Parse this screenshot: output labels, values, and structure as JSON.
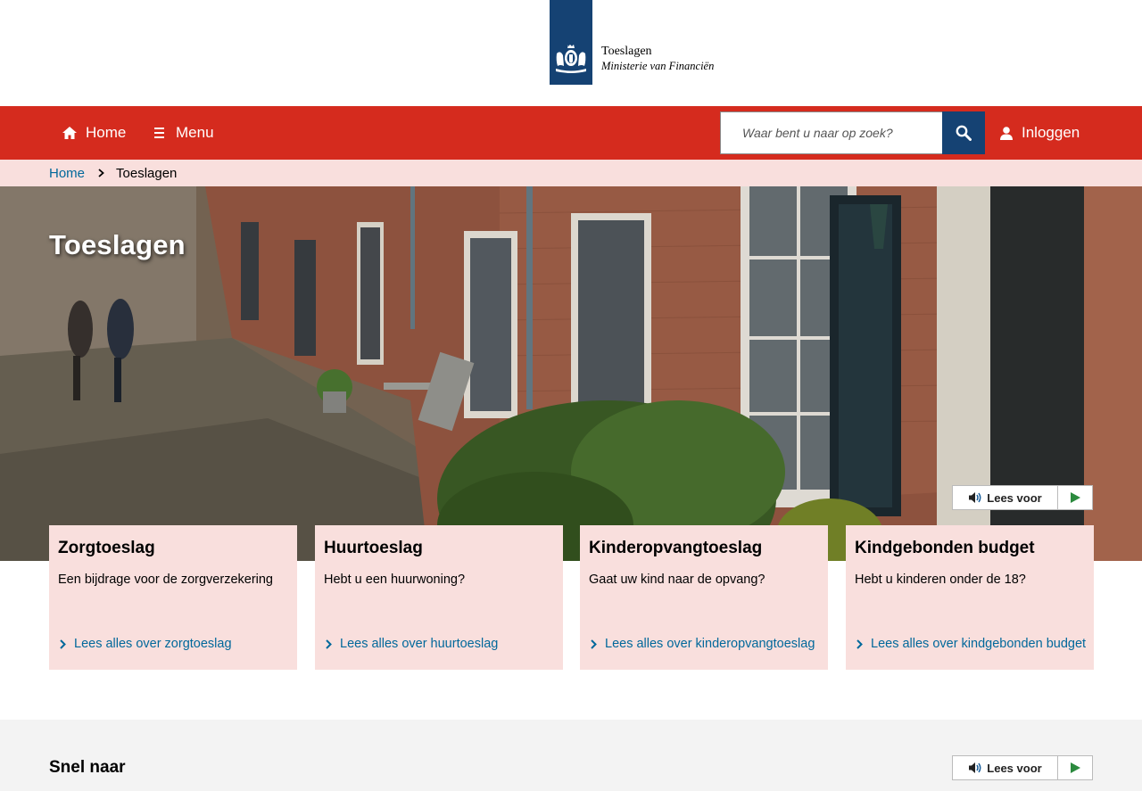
{
  "header": {
    "logo_title": "Toeslagen",
    "logo_subtitle": "Ministerie van Financiën",
    "logo_color": "#154273"
  },
  "nav": {
    "home_label": "Home",
    "menu_label": "Menu",
    "search_placeholder": "Waar bent u naar op zoek?",
    "login_label": "Inloggen",
    "bar_color": "#d52b1e"
  },
  "breadcrumb": {
    "home": "Home",
    "current": "Toeslagen"
  },
  "hero": {
    "title": "Toeslagen",
    "lees_voor": "Lees voor"
  },
  "cards": [
    {
      "title": "Zorgtoeslag",
      "description": "Een bijdrage voor de zorgverzekering",
      "link": "Lees alles over zorgtoeslag"
    },
    {
      "title": "Huurtoeslag",
      "description": "Hebt u een huurwoning?",
      "link": "Lees alles over huurtoeslag"
    },
    {
      "title": "Kinderopvangtoeslag",
      "description": "Gaat uw kind naar de opvang?",
      "link": "Lees alles over kinderopvangtoeslag"
    },
    {
      "title": "Kindgebonden budget",
      "description": "Hebt u kinderen onder de 18?",
      "link": "Lees alles over kindgebonden budget"
    }
  ],
  "snel_naar": {
    "title": "Snel naar",
    "lees_voor": "Lees voor"
  },
  "colors": {
    "link": "#01689b",
    "pink_bg": "#f9dfdd"
  }
}
